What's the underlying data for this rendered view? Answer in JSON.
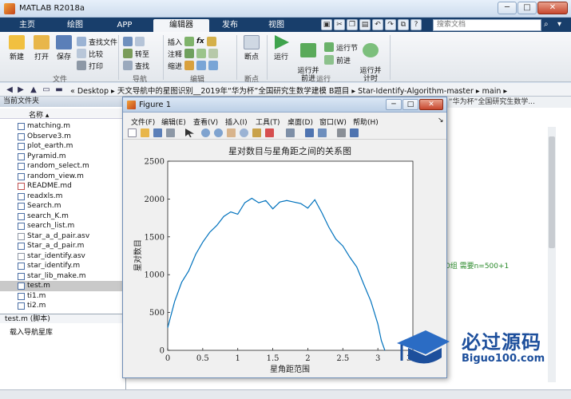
{
  "window": {
    "title": "MATLAB R2018a",
    "minimize": "─",
    "maximize": "□",
    "close": "✕"
  },
  "ribbon_tabs": [
    "主页",
    "绘图",
    "APP",
    "编辑器",
    "发布",
    "视图"
  ],
  "active_tab": "编辑器",
  "search_placeholder": "搜索文档",
  "ribbon": {
    "file_group": {
      "label": "文件",
      "new": "新建",
      "open": "打开",
      "save": "保存",
      "find_files": "查找文件",
      "compare": "比较",
      "print": "打印"
    },
    "nav_group": {
      "label": "导航",
      "goto": "转至",
      "find": "查找"
    },
    "edit_group": {
      "label": "编辑",
      "insert": "插入",
      "comment": "注释",
      "indent": "缩进",
      "fx": "fx"
    },
    "breakpoint_group": {
      "label": "断点",
      "breakpoints": "断点"
    },
    "run_group": {
      "label": "运行",
      "run": "运行",
      "run_advance": "运行并\n前进",
      "run_section": "运行节",
      "advance": "前进",
      "run_time": "运行并\n计时"
    }
  },
  "address": {
    "path": "« Desktop ▸ 天文导航中的星图识别__2019年“华为杯”全国研究生数学建模 B题目 ▸ Star-Identify-Algorithm-master ▸ main ▸"
  },
  "folder_panel": {
    "title": "当前文件夹",
    "col_name": "名称 ▴",
    "files": [
      {
        "name": "matching.m",
        "type": "m"
      },
      {
        "name": "Observe3.m",
        "type": "m"
      },
      {
        "name": "plot_earth.m",
        "type": "m"
      },
      {
        "name": "Pyramid.m",
        "type": "m"
      },
      {
        "name": "random_select.m",
        "type": "m"
      },
      {
        "name": "random_view.m",
        "type": "m"
      },
      {
        "name": "README.md",
        "type": "md"
      },
      {
        "name": "readxls.m",
        "type": "m"
      },
      {
        "name": "Search.m",
        "type": "m"
      },
      {
        "name": "search_K.m",
        "type": "m"
      },
      {
        "name": "search_list.m",
        "type": "m"
      },
      {
        "name": "Star_a_d_pair.asv",
        "type": "asv"
      },
      {
        "name": "Star_a_d_pair.m",
        "type": "m"
      },
      {
        "name": "star_identify.asv",
        "type": "asv"
      },
      {
        "name": "star_identify.m",
        "type": "m"
      },
      {
        "name": "star_lib_make.m",
        "type": "m"
      },
      {
        "name": "test.m",
        "type": "m",
        "selected": true
      },
      {
        "name": "ti1.m",
        "type": "m"
      },
      {
        "name": "ti2.m",
        "type": "m"
      }
    ],
    "details_title": "test.m  (脚本)",
    "details_text": "载入导航星库"
  },
  "right_panel": {
    "header": "“华为杯”全国研究生数学...",
    "visible_text": "0组  需要n=500+1"
  },
  "figure": {
    "title": "Figure 1",
    "menus": [
      "文件(F)",
      "编辑(E)",
      "查看(V)",
      "插入(I)",
      "工具(T)",
      "桌面(D)",
      "窗口(W)",
      "帮助(H)"
    ]
  },
  "chart_data": {
    "type": "line",
    "title": "星对数目与星角距之间的关系图",
    "xlabel": "星角距范围",
    "ylabel": "星对数目",
    "xlim": [
      0,
      3.5
    ],
    "ylim": [
      0,
      2500
    ],
    "xticks": [
      0,
      0.5,
      1,
      1.5,
      2,
      2.5,
      3,
      3.5
    ],
    "xtick_labels": [
      "0",
      "0.5",
      "1",
      "1.5",
      "2",
      "2.5",
      "3",
      "3.5"
    ],
    "yticks": [
      0,
      500,
      1000,
      1500,
      2000,
      2500
    ],
    "ytick_labels": [
      "0",
      "500",
      "1000",
      "1500",
      "2000",
      "2500"
    ],
    "line_color": "#0072bd",
    "x": [
      0,
      0.1,
      0.2,
      0.3,
      0.4,
      0.5,
      0.6,
      0.7,
      0.8,
      0.9,
      1.0,
      1.1,
      1.2,
      1.3,
      1.4,
      1.5,
      1.6,
      1.7,
      1.8,
      1.9,
      2.0,
      2.1,
      2.2,
      2.3,
      2.4,
      2.5,
      2.6,
      2.7,
      2.8,
      2.9,
      3.0,
      3.05,
      3.1
    ],
    "y": [
      300,
      650,
      900,
      1050,
      1270,
      1430,
      1560,
      1650,
      1770,
      1830,
      1800,
      1950,
      2010,
      1950,
      1980,
      1870,
      1960,
      1980,
      1960,
      1940,
      1880,
      1990,
      1820,
      1630,
      1470,
      1380,
      1230,
      1100,
      870,
      650,
      350,
      130,
      0
    ]
  },
  "watermark": {
    "main": "必过源码",
    "sub": "Biguo100.com"
  }
}
